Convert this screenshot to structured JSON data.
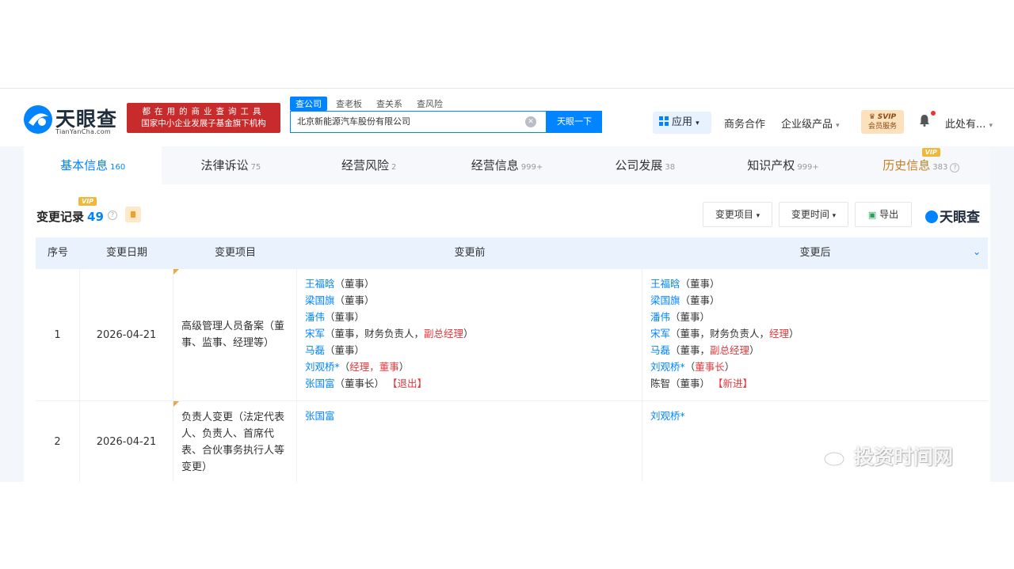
{
  "header": {
    "logo_text": "天眼查",
    "logo_pinyin": "TianYanCha.com",
    "slogan_line1": "都在用的商业查询工具",
    "slogan_line2": "国家中小企业发展子基金旗下机构",
    "search_tabs": [
      "查公司",
      "查老板",
      "查关系",
      "查风险"
    ],
    "search_value": "北京新能源汽车股份有限公司",
    "search_button": "天眼一下",
    "app_label": "应用",
    "nav": [
      "商务合作",
      "企业级产品"
    ],
    "svip_top": "SVIP",
    "svip_bottom": "会员服务",
    "user": "此处有..."
  },
  "tabs": [
    {
      "label": "基本信息",
      "count": "160"
    },
    {
      "label": "法律诉讼",
      "count": "75"
    },
    {
      "label": "经营风险",
      "count": "2"
    },
    {
      "label": "经营信息",
      "count": "999+"
    },
    {
      "label": "公司发展",
      "count": "38"
    },
    {
      "label": "知识产权",
      "count": "999+"
    },
    {
      "label": "历史信息",
      "count": "383"
    }
  ],
  "vip_tag": "VIP",
  "section": {
    "title": "变更记录",
    "count": "49",
    "filter_item": "变更项目",
    "filter_time": "变更时间",
    "export": "导出",
    "brand": "天眼查"
  },
  "table": {
    "headers": [
      "序号",
      "变更日期",
      "变更项目",
      "变更前",
      "变更后"
    ],
    "rows": [
      {
        "index": "1",
        "date": "2026-04-21",
        "item": "高级管理人员备案（董事、监事、经理等）",
        "before": [
          {
            "name": "王福晗",
            "rest": "（董事）"
          },
          {
            "name": "梁国旗",
            "rest": "（董事）"
          },
          {
            "name": "潘伟",
            "rest": "（董事）"
          },
          {
            "name": "宋军",
            "rest": "（董事，财务负责人，",
            "red": "副总经理",
            "tail": "）"
          },
          {
            "name": "马磊",
            "rest": "（董事）"
          },
          {
            "name": "刘观桥*",
            "rest": "（",
            "red": "经理，董事",
            "tail": "）"
          },
          {
            "name": "张国富",
            "rest": "（董事长）",
            "red2": "【退出】"
          }
        ],
        "after": [
          {
            "name": "王福晗",
            "rest": "（董事）"
          },
          {
            "name": "梁国旗",
            "rest": "（董事）"
          },
          {
            "name": "潘伟",
            "rest": "（董事）"
          },
          {
            "name": "宋军",
            "rest": "（董事，财务负责人，",
            "red": "经理",
            "tail": "）"
          },
          {
            "name": "马磊",
            "rest": "（董事，",
            "red": "副总经理",
            "tail": "）"
          },
          {
            "name": "刘观桥*",
            "rest": "（",
            "red": "董事长",
            "tail": "）"
          },
          {
            "name": "陈智",
            "rest": "（董事）",
            "red2": "【新进】",
            "plain": true
          }
        ]
      },
      {
        "index": "2",
        "date": "2026-04-21",
        "item": "负责人变更（法定代表人、负责人、首席代表、合伙事务执行人等变更）",
        "before_text": "张国富",
        "after_text": "刘观桥*"
      }
    ]
  },
  "watermark": "投资时间网"
}
